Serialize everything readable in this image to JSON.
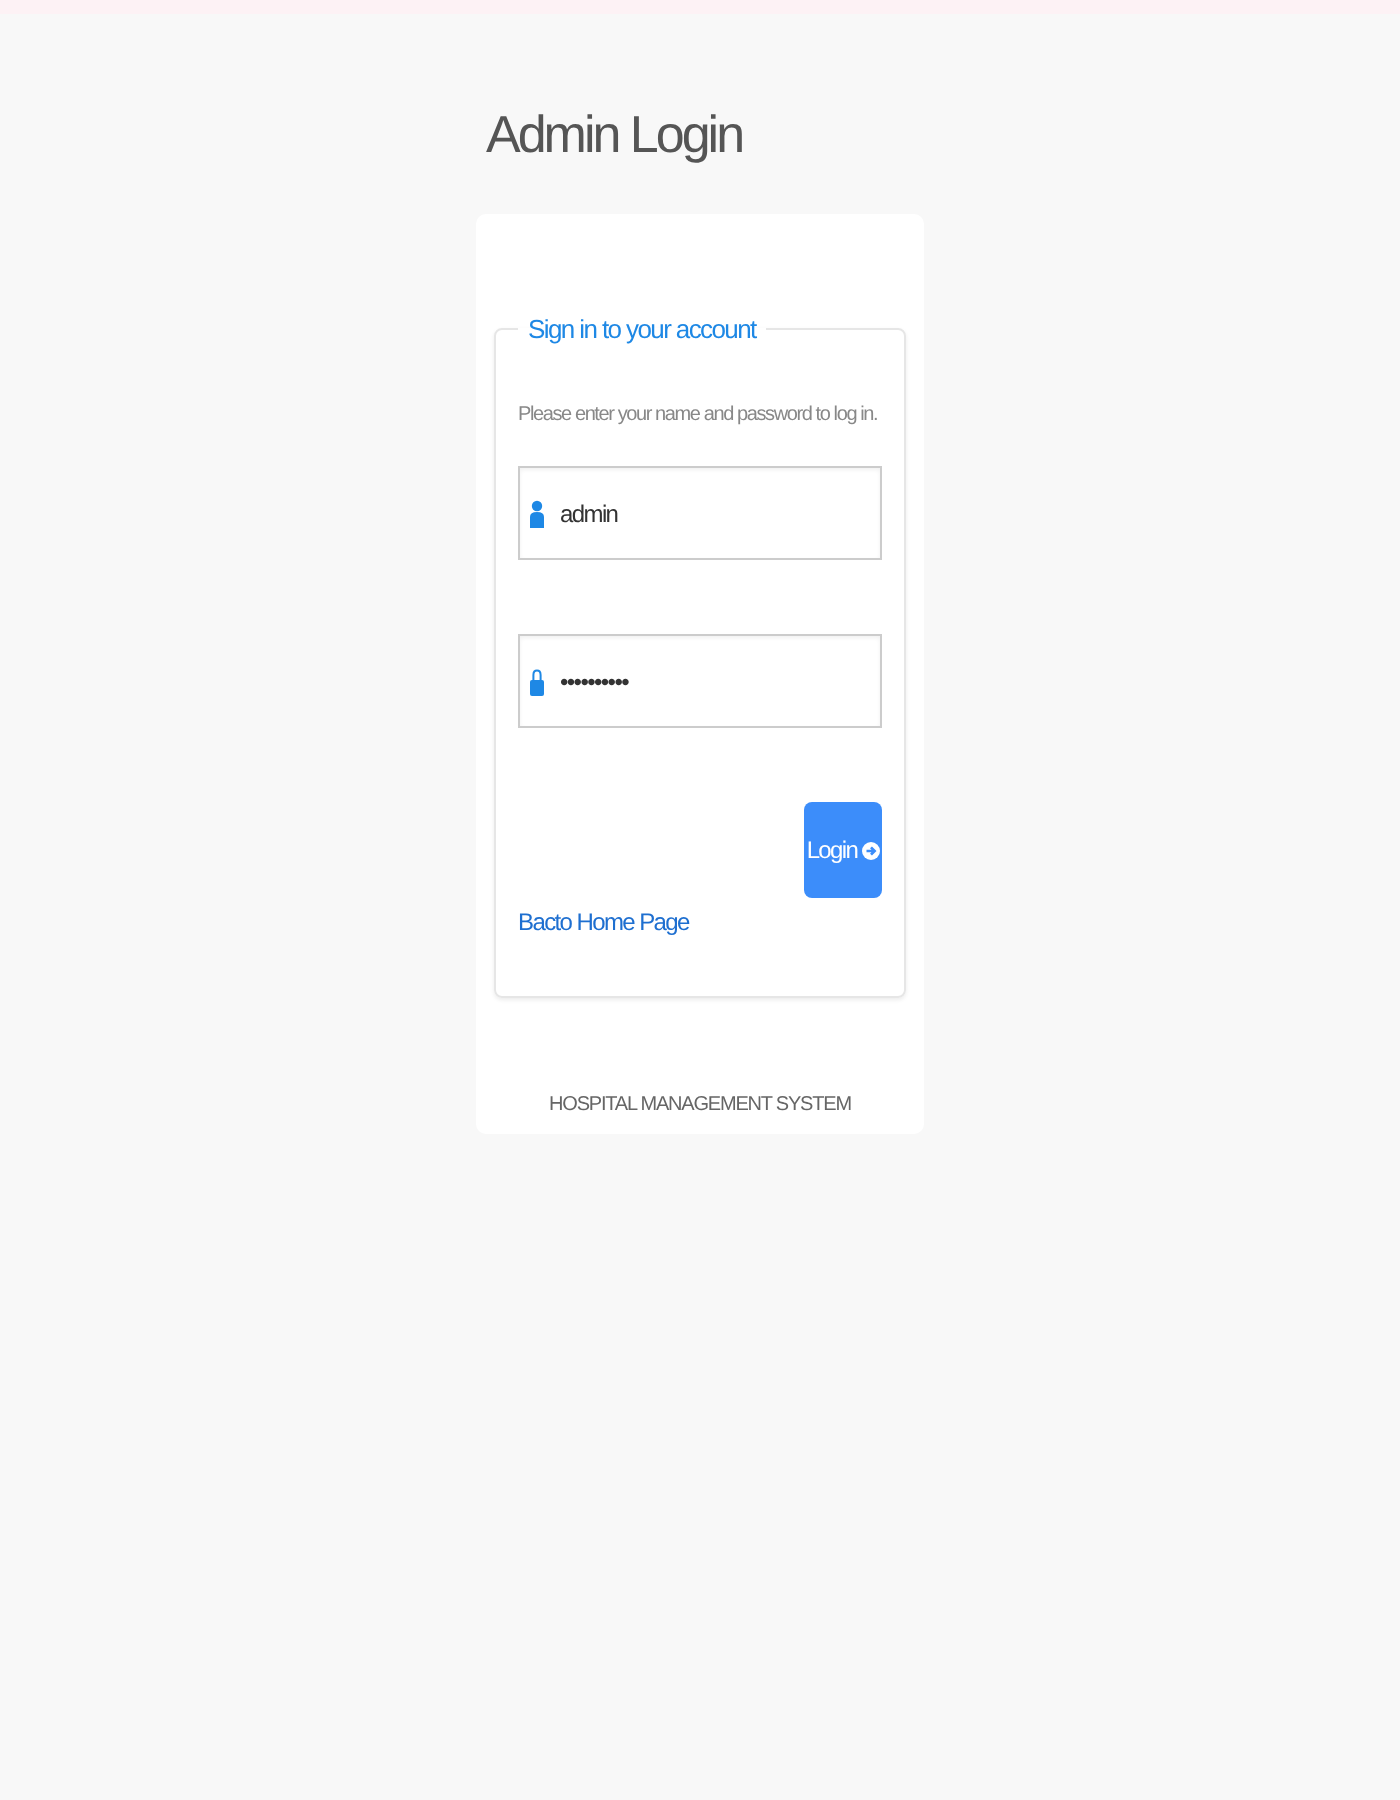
{
  "title": "Admin Login",
  "form": {
    "legend": "Sign in to your account",
    "instruction": "Please enter your name and password to log in.",
    "fields": [
      {
        "kind": "user",
        "value": "admin"
      },
      {
        "kind": "password",
        "value": "••••••••••"
      }
    ],
    "submit": "Login",
    "back_link": "Bacto Home Page"
  },
  "footer": "HOSPITAL MANAGEMENT SYSTEM"
}
